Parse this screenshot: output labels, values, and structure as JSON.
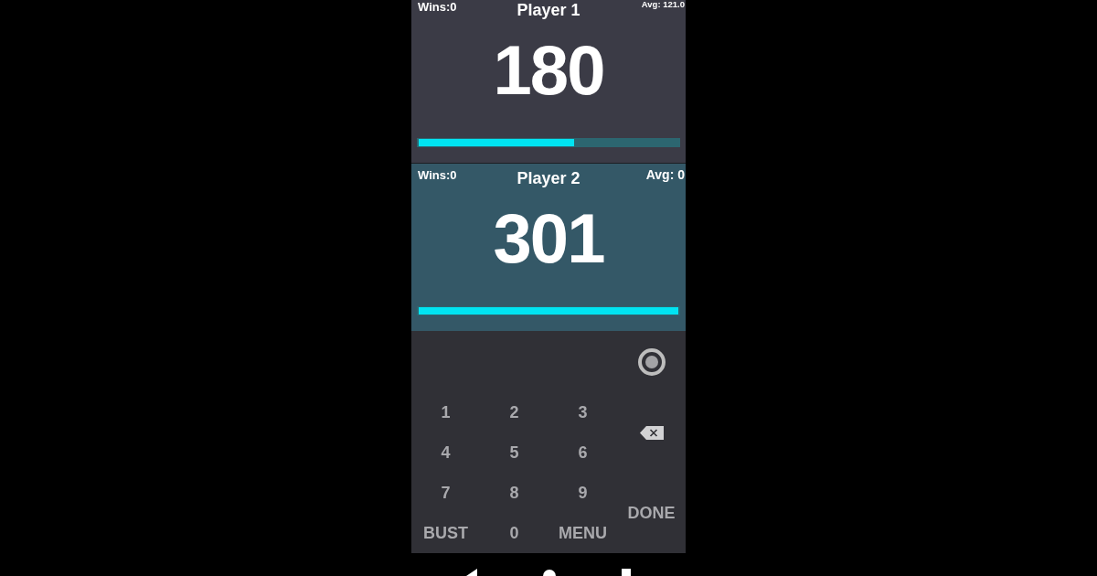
{
  "players": [
    {
      "wins": "Wins:0",
      "name": "Player 1",
      "avg": "Avg: 121.0",
      "score": "180",
      "level": 0.6,
      "selected": false
    },
    {
      "wins": "Wins:0",
      "name": "Player 2",
      "avg": "Avg: 0",
      "score": "301",
      "level": 1,
      "selected": true
    }
  ],
  "keypad": {
    "keys": [
      "1",
      "2",
      "3",
      "4",
      "5",
      "6",
      "7",
      "8",
      "9",
      "BUST",
      "0",
      "MENU"
    ],
    "done": "DONE"
  }
}
